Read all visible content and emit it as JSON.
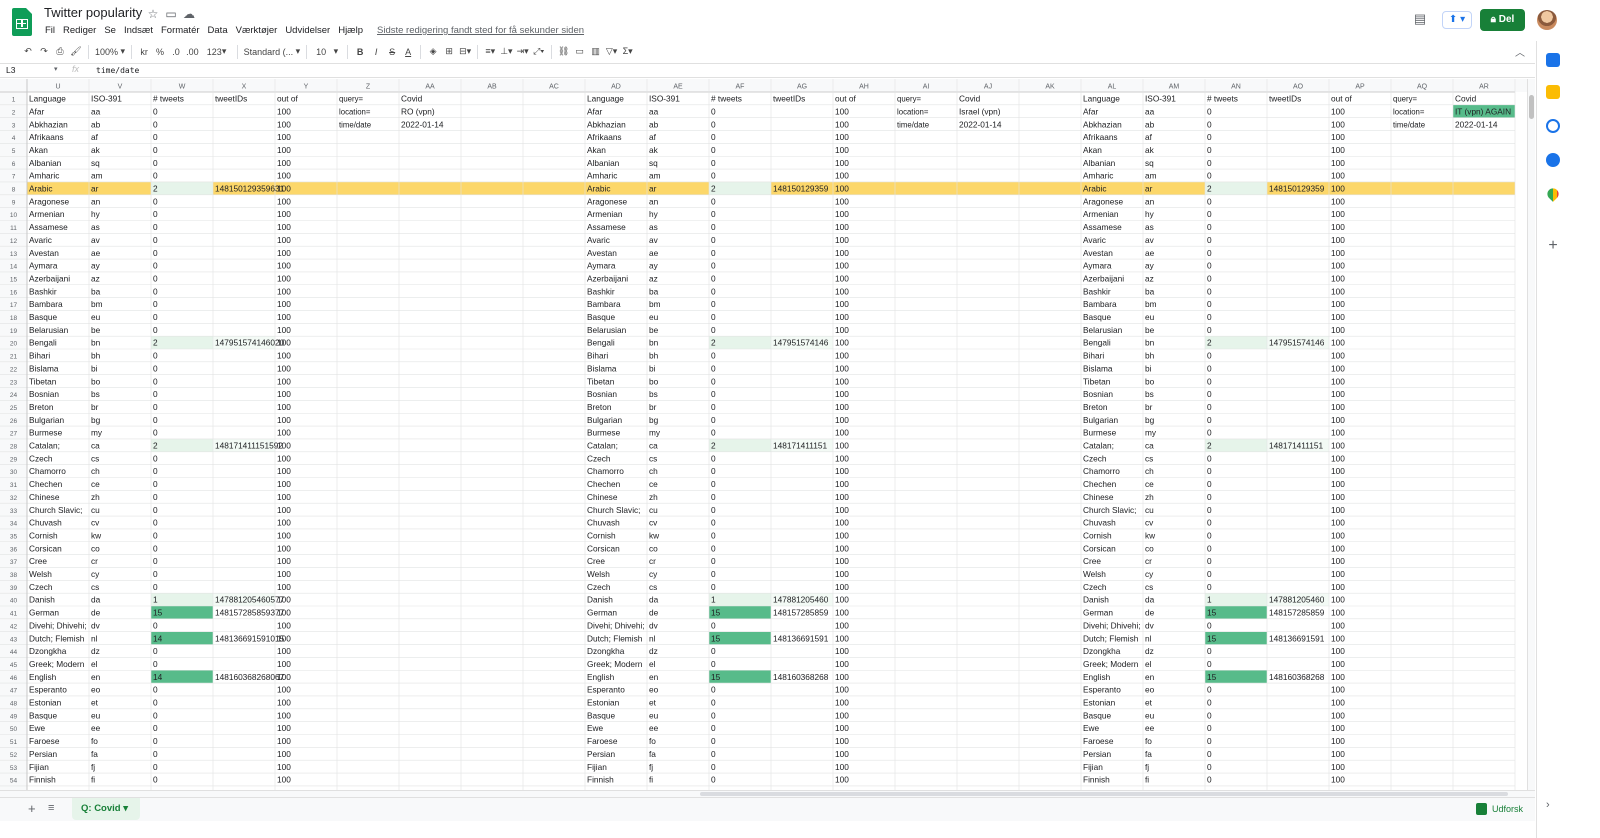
{
  "document": {
    "title": "Twitter popularity",
    "last_edit": "Sidste redigering fandt sted for få sekunder siden"
  },
  "menu": [
    "Fil",
    "Rediger",
    "Se",
    "Indsæt",
    "Formatér",
    "Data",
    "Værktøjer",
    "Udvidelser",
    "Hjælp"
  ],
  "header_buttons": {
    "share": "Del",
    "share_icon": "lock-icon",
    "present_icon": "present-icon",
    "comment_icon": "comment-icon"
  },
  "toolbar": {
    "zoom": "100%",
    "currency": "kr",
    "percent": "%",
    "decrease_decimals": ".0",
    "increase_decimals": ".00",
    "more_formats": "123",
    "font": "Standard (...",
    "font_size": "10",
    "icons": [
      "undo-icon",
      "redo-icon",
      "print-icon",
      "paint-format-icon",
      "bold-icon",
      "italic-icon",
      "strikethrough-icon",
      "text-color-icon",
      "fill-color-icon",
      "borders-icon",
      "merge-cells-icon",
      "horizontal-align-icon",
      "vertical-align-icon",
      "text-wrap-icon",
      "text-rotation-icon",
      "link-icon",
      "comment-icon",
      "chart-icon",
      "filter-icon",
      "functions-icon"
    ]
  },
  "formula_bar": {
    "cell_ref": "L3",
    "content": "time/date",
    "fx": "fx"
  },
  "colors": {
    "highlight_row": "#fcd76a",
    "green_strong": "#57bb8a",
    "green_light": "#e6f4ea",
    "brand_green": "#188038"
  },
  "grid": {
    "rows_shown": [
      "1",
      "2",
      "3",
      "4",
      "5",
      "6",
      "7",
      "8",
      "9",
      "10",
      "11",
      "12",
      "13",
      "14",
      "15",
      "16",
      "17",
      "18",
      "19",
      "20",
      "21",
      "22",
      "23",
      "24",
      "25",
      "26",
      "27",
      "28",
      "29",
      "30",
      "31",
      "32",
      "33",
      "34",
      "35",
      "36",
      "37",
      "38",
      "39",
      "40",
      "41",
      "42",
      "43",
      "44",
      "45",
      "46",
      "47",
      "48",
      "49",
      "50",
      "51",
      "52",
      "53",
      "54"
    ],
    "highlighted_row": 8,
    "group_headers": [
      "Language",
      "ISO-391",
      "# tweets",
      "tweetIDs",
      "out of"
    ],
    "languages": [
      [
        "Afar",
        "aa"
      ],
      [
        "Abkhazian",
        "ab"
      ],
      [
        "Afrikaans",
        "af"
      ],
      [
        "Akan",
        "ak"
      ],
      [
        "Albanian",
        "sq"
      ],
      [
        "Amharic",
        "am"
      ],
      [
        "Arabic",
        "ar"
      ],
      [
        "Aragonese",
        "an"
      ],
      [
        "Armenian",
        "hy"
      ],
      [
        "Assamese",
        "as"
      ],
      [
        "Avaric",
        "av"
      ],
      [
        "Avestan",
        "ae"
      ],
      [
        "Aymara",
        "ay"
      ],
      [
        "Azerbaijani",
        "az"
      ],
      [
        "Bashkir",
        "ba"
      ],
      [
        "Bambara",
        "bm"
      ],
      [
        "Basque",
        "eu"
      ],
      [
        "Belarusian",
        "be"
      ],
      [
        "Bengali",
        "bn"
      ],
      [
        "Bihari",
        "bh"
      ],
      [
        "Bislama",
        "bi"
      ],
      [
        "Tibetan",
        "bo"
      ],
      [
        "Bosnian",
        "bs"
      ],
      [
        "Breton",
        "br"
      ],
      [
        "Bulgarian",
        "bg"
      ],
      [
        "Burmese",
        "my"
      ],
      [
        "Catalan;",
        "ca"
      ],
      [
        "Czech",
        "cs"
      ],
      [
        "Chamorro",
        "ch"
      ],
      [
        "Chechen",
        "ce"
      ],
      [
        "Chinese",
        "zh"
      ],
      [
        "Church Slavic;",
        "cu"
      ],
      [
        "Chuvash",
        "cv"
      ],
      [
        "Cornish",
        "kw"
      ],
      [
        "Corsican",
        "co"
      ],
      [
        "Cree",
        "cr"
      ],
      [
        "Welsh",
        "cy"
      ],
      [
        "Czech",
        "cs"
      ],
      [
        "Danish",
        "da"
      ],
      [
        "German",
        "de"
      ],
      [
        "Divehi; Dhivehi;",
        "dv"
      ],
      [
        "Dutch; Flemish",
        "nl"
      ],
      [
        "Dzongkha",
        "dz"
      ],
      [
        "Greek; Modern",
        "el"
      ],
      [
        "English",
        "en"
      ],
      [
        "Esperanto",
        "eo"
      ],
      [
        "Estonian",
        "et"
      ],
      [
        "Basque",
        "eu"
      ],
      [
        "Ewe",
        "ee"
      ],
      [
        "Faroese",
        "fo"
      ],
      [
        "Persian",
        "fa"
      ],
      [
        "Fijian",
        "fj"
      ],
      [
        "Finnish",
        "fi"
      ]
    ],
    "out_of_value": "100",
    "blocks": [
      {
        "cols": [
          "U",
          "V",
          "W",
          "X",
          "Y",
          "Z",
          "AA",
          "AB",
          "AC"
        ],
        "meta": [
          [
            "query=",
            "Covid"
          ],
          [
            "location=",
            "RO (vpn)"
          ],
          [
            "time/date",
            "2022-01-14"
          ]
        ],
        "tweets": {
          "8": "2",
          "20": "2",
          "28": "2",
          "40": "1",
          "41": "15",
          "43": "14",
          "46": "14"
        },
        "tweet_ids": {
          "8": "148150129359631",
          "20": "147951574146020",
          "28": "148171411151592",
          "40": "147881205460577",
          "41": "148157285859377",
          "43": "148136691591015",
          "46": "148160368268067"
        }
      },
      {
        "cols": [
          "AD",
          "AE",
          "AF",
          "AG",
          "AH",
          "AI",
          "AJ",
          "AK"
        ],
        "meta": [
          [
            "query=",
            "Covid"
          ],
          [
            "location=",
            "Israel (vpn)"
          ],
          [
            "time/date",
            "2022-01-14"
          ]
        ],
        "tweets": {
          "8": "2",
          "20": "2",
          "28": "2",
          "40": "1",
          "41": "15",
          "43": "15",
          "46": "15"
        },
        "tweet_ids": {
          "8": "148150129359",
          "20": "147951574146",
          "28": "148171411151",
          "40": "147881205460",
          "41": "148157285859",
          "43": "148136691591",
          "46": "148160368268"
        }
      },
      {
        "cols": [
          "AL",
          "AM",
          "AN",
          "AO",
          "AP",
          "AQ",
          "AR"
        ],
        "meta": [
          [
            "query=",
            "Covid"
          ],
          [
            "location=",
            "IT (vpn) AGAIN"
          ],
          [
            "time/date",
            "2022-01-14"
          ]
        ],
        "tweets": {
          "8": "2",
          "20": "2",
          "28": "2",
          "40": "1",
          "41": "15",
          "43": "15",
          "46": "15"
        },
        "tweet_ids": {
          "8": "148150129359",
          "20": "147951574146",
          "28": "148171411151",
          "40": "147881205460",
          "41": "148157285859",
          "43": "148136691591",
          "46": "148160368268"
        }
      }
    ]
  },
  "sheet_tabs": [
    {
      "label": "Q: Covid",
      "active": true
    }
  ],
  "bottom": {
    "explore": "Udforsk",
    "add_sheet": "+",
    "all_sheets": "≡"
  },
  "side_panel_icons": [
    "sheets-icon",
    "keep-icon",
    "tasks-icon",
    "contacts-icon",
    "maps-icon",
    "add-icon"
  ]
}
